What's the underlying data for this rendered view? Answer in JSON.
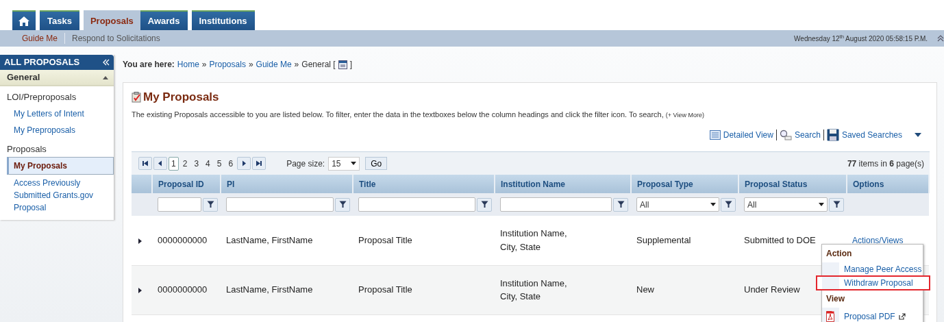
{
  "tabs": [
    {
      "kind": "home",
      "selected": false
    },
    {
      "kind": "text",
      "label": "Tasks",
      "selected": false
    },
    {
      "kind": "text",
      "label": "Proposals",
      "selected": true
    },
    {
      "kind": "text",
      "label": "Awards",
      "selected": false
    },
    {
      "kind": "text",
      "label": "Institutions",
      "selected": false
    }
  ],
  "subnav": [
    {
      "label": "Guide Me",
      "selected": true
    },
    {
      "label": "Respond to Solicitations",
      "selected": false
    }
  ],
  "datetime": "Wednesday 12$^{th}$ August 2020 05:58:15 P.M.",
  "sidebar": {
    "title": "ALL PROPOSALS",
    "section": "General",
    "expanded": true,
    "groups": [
      {
        "heading": "LOI/Preproposals",
        "items": [
          {
            "label": "My Letters of Intent",
            "selected": false
          },
          {
            "label": "My Preproposals",
            "selected": false
          }
        ]
      },
      {
        "heading": "Proposals",
        "items": [
          {
            "label": "My Proposals",
            "selected": true
          },
          {
            "label": "Access Previously Submitted Grants.gov Proposal",
            "selected": false
          }
        ]
      }
    ]
  },
  "breadcrumb": {
    "label": "You are here:",
    "links": [
      "Home",
      "Proposals",
      "Guide Me"
    ],
    "separator": "»",
    "current": "General [",
    "current_end": "]"
  },
  "panel": {
    "title": "My Proposals",
    "description": "The existing Proposals accessible to you are listed below. To filter, enter the data in the textboxes below the column headings and click the filter icon. To search,",
    "view_more": "(+ View More)",
    "toolbar": [
      {
        "kind": "detailed",
        "label": "Detailed View"
      },
      {
        "kind": "search",
        "label": "Search"
      },
      {
        "kind": "saved",
        "label": "Saved Searches"
      }
    ]
  },
  "pager": {
    "pages": [
      {
        "label": "1",
        "selected": true
      },
      {
        "label": "2",
        "selected": false
      },
      {
        "label": "3",
        "selected": false
      },
      {
        "label": "4",
        "selected": false
      },
      {
        "label": "5",
        "selected": false
      },
      {
        "label": "6",
        "selected": false
      }
    ],
    "page_size_label": "Page size:",
    "page_size": "15",
    "go": "Go",
    "summary": "**77** items in **6** page(s)"
  },
  "table": {
    "columns": [
      "Proposal ID",
      "PI",
      "Title",
      "Institution Name",
      "Proposal Type",
      "Proposal Status",
      "Options"
    ],
    "filters": [
      {
        "kind": "text"
      },
      {
        "kind": "text"
      },
      {
        "kind": "text"
      },
      {
        "kind": "text"
      },
      {
        "kind": "select",
        "value": "All"
      },
      {
        "kind": "select",
        "value": "All"
      },
      {
        "kind": "none"
      }
    ],
    "rows": [
      {
        "cells": [
          "0000000000",
          "LastName, FirstName",
          "Proposal Title",
          "Institution Name, City, State",
          "Supplemental",
          "Submitted to DOE",
          "Actions/Views"
        ]
      },
      {
        "cells": [
          "0000000000",
          "LastName, FirstName",
          "Proposal Title",
          "Institution Name, City, State",
          "New",
          "Under Review",
          ""
        ]
      }
    ]
  },
  "menu": {
    "sections": [
      {
        "heading": "Action",
        "items": [
          {
            "label": "Manage Peer Access",
            "highlighted": false,
            "kind": "plain"
          },
          {
            "label": "Withdraw Proposal",
            "highlighted": true,
            "kind": "plain"
          }
        ]
      },
      {
        "heading": "View",
        "items": [
          {
            "label": "Proposal PDF",
            "highlighted": false,
            "kind": "pdf"
          }
        ]
      }
    ]
  }
}
